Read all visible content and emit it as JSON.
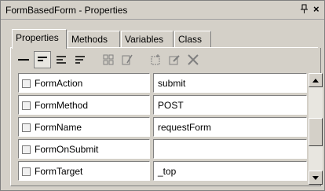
{
  "window": {
    "title": "FormBasedForm - Properties",
    "pin_icon": "pin-icon",
    "close_glyph": "×"
  },
  "tabs": [
    {
      "label": "Properties",
      "active": true
    },
    {
      "label": "Methods",
      "active": false
    },
    {
      "label": "Variables",
      "active": false
    },
    {
      "label": "Class",
      "active": false
    }
  ],
  "toolbar": {
    "buttons": [
      {
        "icon": "no-indent-icon",
        "selected": false
      },
      {
        "icon": "indent-small-icon",
        "selected": true
      },
      {
        "icon": "indent-medium-icon",
        "selected": false
      },
      {
        "icon": "indent-large-icon",
        "selected": false
      },
      {
        "icon": "view-grid-icon",
        "selected": false
      },
      {
        "icon": "edit-link-icon",
        "selected": false
      },
      {
        "icon": "new-item-icon",
        "selected": false
      },
      {
        "icon": "edit-item-icon",
        "selected": false
      },
      {
        "icon": "delete-icon",
        "selected": false
      }
    ]
  },
  "properties": [
    {
      "name": "FormAction",
      "value": "submit"
    },
    {
      "name": "FormMethod",
      "value": "POST"
    },
    {
      "name": "FormName",
      "value": "requestForm"
    },
    {
      "name": "FormOnSubmit",
      "value": ""
    },
    {
      "name": "FormTarget",
      "value": "_top"
    }
  ],
  "colors": {
    "panel_bg": "#d4d0c8",
    "cell_bg": "#ffffff",
    "border_dark": "#808080"
  }
}
